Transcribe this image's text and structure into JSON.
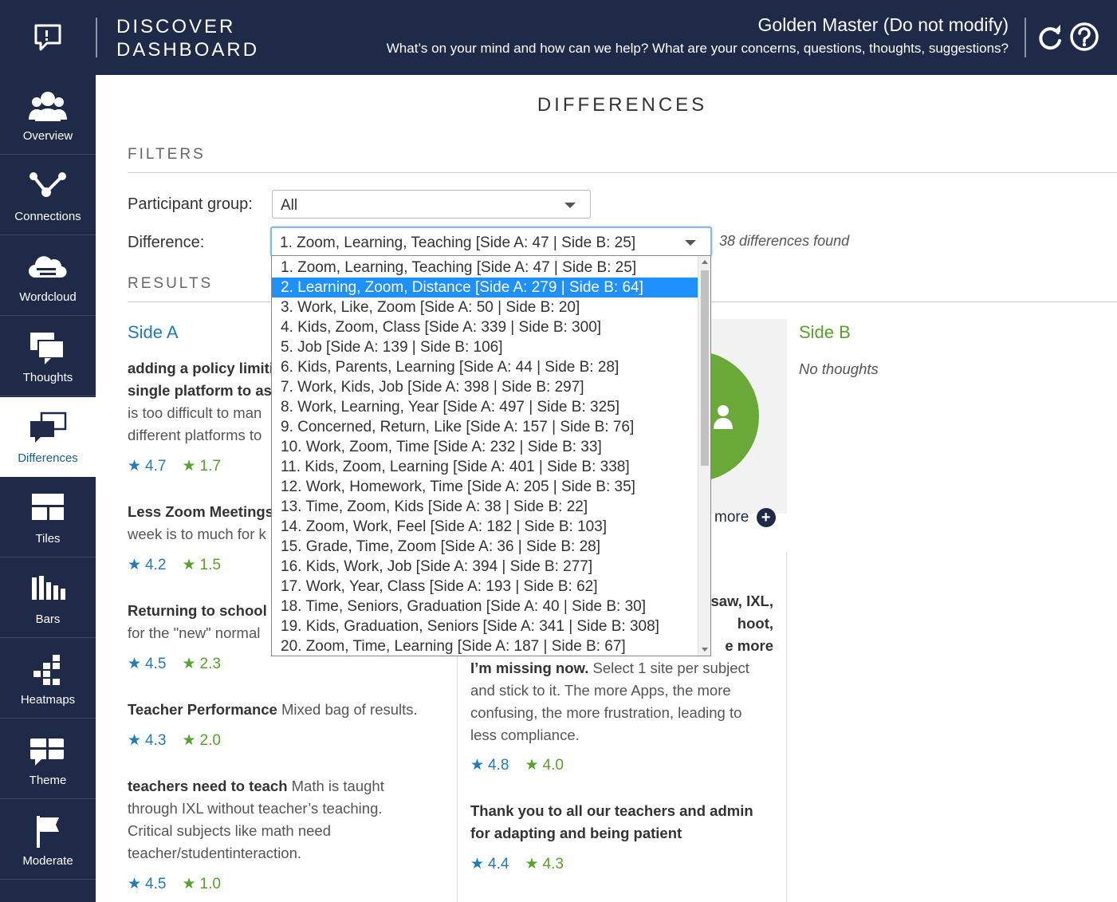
{
  "header": {
    "app_title_line1": "DISCOVER",
    "app_title_line2": "DASHBOARD",
    "project_title": "Golden Master (Do not modify)",
    "project_question": "What’s on your mind and how can we help? What are your concerns, questions, thoughts, suggestions?",
    "icons": [
      "chat-bubble-icon",
      "refresh-icon",
      "help-icon"
    ]
  },
  "sidebar": {
    "items": [
      {
        "label": "Overview",
        "icon": "people-icon"
      },
      {
        "label": "Connections",
        "icon": "network-icon"
      },
      {
        "label": "Wordcloud",
        "icon": "cloud-icon"
      },
      {
        "label": "Thoughts",
        "icon": "thoughts-icon"
      },
      {
        "label": "Differences",
        "icon": "differences-icon",
        "active": true
      },
      {
        "label": "Tiles",
        "icon": "tiles-icon"
      },
      {
        "label": "Bars",
        "icon": "bars-icon"
      },
      {
        "label": "Heatmaps",
        "icon": "heatmap-icon"
      },
      {
        "label": "Theme",
        "icon": "theme-icon"
      },
      {
        "label": "Moderate",
        "icon": "flag-icon"
      }
    ]
  },
  "page": {
    "title": "DIFFERENCES",
    "filters_heading": "FILTERS",
    "results_heading": "RESULTS",
    "participant_label": "Participant group:",
    "participant_value": "All",
    "difference_label": "Difference:",
    "difference_value": "1. Zoom, Learning, Teaching [Side A: 47 | Side B: 25]",
    "found_text": "38 differences found"
  },
  "dropdown": {
    "highlighted_index": 1,
    "options": [
      "1. Zoom, Learning, Teaching [Side A: 47 | Side B: 25]",
      "2. Learning, Zoom, Distance [Side A: 279 | Side B: 64]",
      "3. Work, Like, Zoom [Side A: 50 | Side B: 20]",
      "4. Kids, Zoom, Class [Side A: 339 | Side B: 300]",
      "5. Job [Side A: 139 | Side B: 106]",
      "6. Kids, Parents, Learning [Side A: 44 | Side B: 28]",
      "7. Work, Kids, Job [Side A: 398 | Side B: 297]",
      "8. Work, Learning, Year [Side A: 497 | Side B: 325]",
      "9. Concerned, Return, Like [Side A: 157 | Side B: 76]",
      "10. Work, Zoom, Time [Side A: 232 | Side B: 33]",
      "11. Kids, Zoom, Learning [Side A: 401 | Side B: 338]",
      "12. Work, Homework, Time [Side A: 205 | Side B: 35]",
      "13. Time, Zoom, Kids [Side A: 38 | Side B: 22]",
      "14. Zoom, Work, Feel [Side A: 182 | Side B: 103]",
      "15. Grade, Time, Zoom [Side A: 36 | Side B: 28]",
      "16. Kids, Work, Job [Side A: 394 | Side B: 277]",
      "17. Work, Year, Class [Side A: 193 | Side B: 62]",
      "18. Time, Seniors, Graduation [Side A: 40 | Side B: 30]",
      "19. Kids, Graduation, Seniors [Side A: 341 | Side B: 308]",
      "20. Zoom, Time, Learning [Side A: 187 | Side B: 67]"
    ]
  },
  "side_a": {
    "heading": "Side A",
    "color": "#1f7cb8",
    "cards": [
      {
        "line1_bold": "adding a policy limiti",
        "line2_bold": "single platform to as",
        "line3": "is too difficult to man",
        "line4": "different platforms to",
        "rating_a": "4.7",
        "rating_b": "1.7"
      },
      {
        "line1_bold": "Less Zoom Meetings",
        "line2": "week is to much for k",
        "rating_a": "4.2",
        "rating_b": "1.5"
      },
      {
        "line1_bold": "Returning to school",
        "line2": "for the \"new\" normal",
        "rating_a": "4.5",
        "rating_b": "2.3"
      },
      {
        "line1_bold": "Teacher Performance",
        "line1_rest": " Mixed bag of results.",
        "rating_a": "4.3",
        "rating_b": "2.0"
      },
      {
        "line1_bold": "teachers need to teach",
        "line1_rest": " Math is taught",
        "line2": "through IXL without teacher’s teaching.",
        "line3": "Critical subjects like math need",
        "line4": "teacher/studentinteraction.",
        "rating_a": "4.5",
        "rating_b": "1.0"
      }
    ]
  },
  "middle": {
    "more_label": "more",
    "card1": {
      "frag1": "saw, IXL,",
      "frag2": "hoot,",
      "frag3": "e more",
      "line4_bold": "I’m missing now.",
      "line4_rest": "  Select 1 site per subject",
      "line5": "and stick to it. The more Apps, the more",
      "line6": "confusing, the more frustration, leading to",
      "line7": "less compliance.",
      "rating_a": "4.8",
      "rating_b": "4.0"
    },
    "card2": {
      "line1_bold": "Thank you to all our teachers and admin",
      "line2_bold": "for adapting and being patient",
      "rating_a": "4.4",
      "rating_b": "4.3"
    }
  },
  "side_b": {
    "heading": "Side B",
    "color": "#5aa02c",
    "empty_text": "No thoughts"
  }
}
